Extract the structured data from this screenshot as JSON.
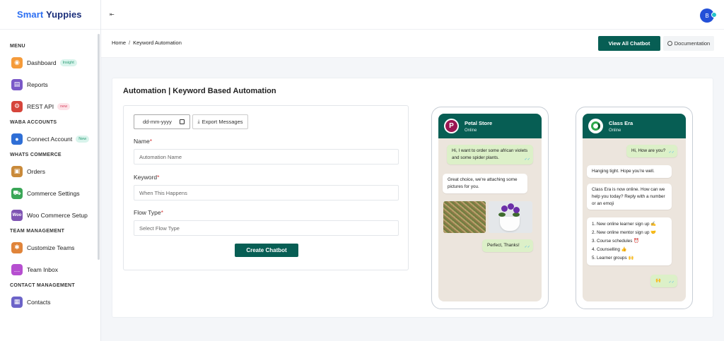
{
  "brand": {
    "part1": "Smart ",
    "part2": "Yuppies"
  },
  "sidebar": {
    "sections": [
      {
        "title": "MENU",
        "items": [
          {
            "label": "Dashboard",
            "badge": "Insight"
          },
          {
            "label": "Reports"
          },
          {
            "label": "REST API",
            "badge": "new"
          }
        ]
      },
      {
        "title": "WABA ACCOUNTS",
        "items": [
          {
            "label": "Connect Account",
            "badge": "New"
          }
        ]
      },
      {
        "title": "WHATS COMMERCE",
        "items": [
          {
            "label": "Orders"
          },
          {
            "label": "Commerce Settings"
          },
          {
            "label": "Woo Commerce Setup"
          }
        ]
      },
      {
        "title": "TEAM MANAGEMENT",
        "items": [
          {
            "label": "Customize Teams"
          },
          {
            "label": "Team Inbox"
          }
        ]
      },
      {
        "title": "CONTACT MANAGEMENT",
        "items": [
          {
            "label": "Contacts"
          }
        ]
      }
    ]
  },
  "topbar": {
    "collapse_icon": "⇤",
    "avatar_letter": "B"
  },
  "breadcrumb": {
    "home": "Home",
    "separator": "/",
    "current": "Keyword Automation"
  },
  "actions": {
    "view_all": "View All Chatbot",
    "documentation": "Documentation"
  },
  "card": {
    "title": "Automation | Keyword Based Automation"
  },
  "form": {
    "date_placeholder": "dd-mm-yyyy",
    "export_label": "Export Messages",
    "name_label": "Name",
    "name_placeholder": "Automation Name",
    "keyword_label": "Keyword",
    "keyword_placeholder": "When This Happens",
    "flow_label": "Flow Type",
    "flow_placeholder": "Select Flow Type",
    "required_mark": "*",
    "submit_label": "Create Chatbot"
  },
  "phones": [
    {
      "name": "Petal Store",
      "status": "Online",
      "avatar_letter": "P",
      "messages": {
        "m1": "Hi, I want to order some african violets and some spider plants.",
        "m2": "Great choice, we're attaching some pictures for you.",
        "m3": "Perfect, Thanks!"
      }
    },
    {
      "name": "Class Era",
      "status": "Online",
      "messages": {
        "m1": "Hi, How are you?",
        "m2": "Hanging tight. Hope you're well.",
        "m3": "Class Era is now online. How can we help you today? Reply with a number or an emoji",
        "list": [
          "1. New online learner sign up ✍️",
          "2. New online mentor sign up 🤝",
          "3. Course schedules ⏰",
          "4. Counselling 👍",
          "5. Learner groups 🙌"
        ],
        "m4": "🙌"
      }
    }
  ],
  "colors": {
    "accent": "#075e54",
    "brand_blue": "#2b6ef2",
    "chat_bg": "#ece5dd",
    "out_bubble": "#dcf0c8"
  }
}
